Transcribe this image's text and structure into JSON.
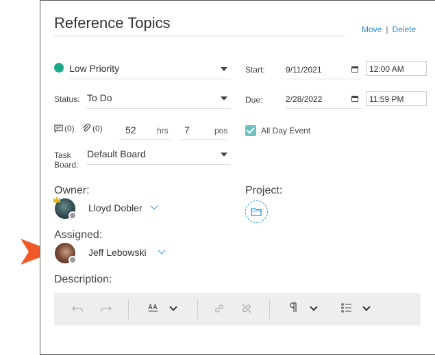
{
  "task": {
    "title": "Reference Topics",
    "move_label": "Move",
    "separator": "|",
    "delete_label": "Delete"
  },
  "priority": {
    "value": "Low Priority",
    "color": "#1ba98a"
  },
  "status": {
    "label": "Status:",
    "value": "To Do"
  },
  "start": {
    "label": "Start:",
    "date": "9/11/2021",
    "time": "12:00 AM"
  },
  "due": {
    "label": "Due:",
    "date": "2/28/2022",
    "time": "11:59 PM"
  },
  "counts": {
    "notes": "(0)",
    "attachments": "(0)"
  },
  "estimate": {
    "hours": "52",
    "hours_unit": "hrs",
    "pos": "7",
    "pos_unit": "pos"
  },
  "all_day": {
    "label": "All Day Event",
    "checked": true
  },
  "task_board": {
    "label_line1": "Task",
    "label_line2": "Board:",
    "value": "Default Board"
  },
  "owner": {
    "label": "Owner:",
    "name": "Lloyd Dobler"
  },
  "project": {
    "label": "Project:"
  },
  "assigned": {
    "label": "Assigned:",
    "name": "Jeff Lebowski"
  },
  "description": {
    "label": "Description:"
  },
  "colors": {
    "accent": "#2a8fd6",
    "checkbox": "#6cc4c0",
    "arrow": "#f05a28",
    "toolbar": "#eeeeee"
  }
}
